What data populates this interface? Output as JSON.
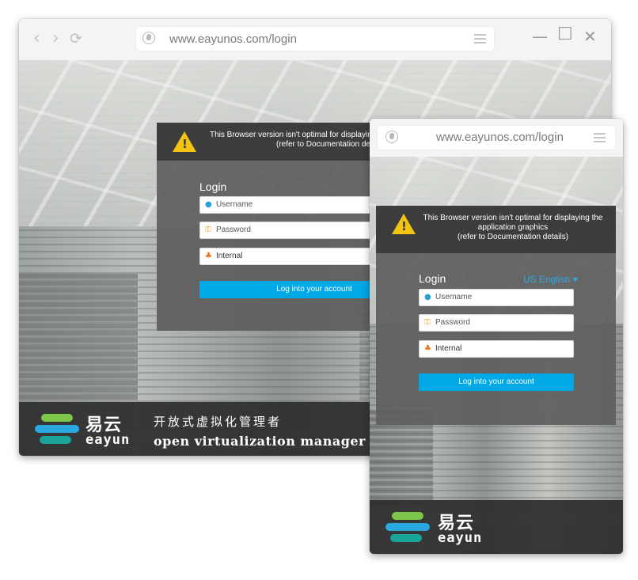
{
  "browser": {
    "url": "www.eayunos.com/login",
    "nav": {
      "back": "‹",
      "forward": "›",
      "reload": "⟳"
    },
    "window_controls": {
      "minimize": "—",
      "maximize": "☐",
      "close": "✕"
    }
  },
  "login_page": {
    "warning_line1": "This Browser version isn't optimal for displaying the application graphics",
    "warning_line1_cut": "This Browser version isn't optimal for displaying",
    "warning_line2_cut": "(refer to Documentation det",
    "warning_a": "This Browser version isn't optimal for displaying the",
    "warning_b": "application graphics",
    "warning_c": "(refer to Documentation details)",
    "login_label": "Login",
    "locale": "US English ▾",
    "username_placeholder": "Username",
    "password_placeholder": "Password",
    "profile_value": "Internal",
    "login_button": "Log into your account"
  },
  "branding": {
    "logo_cn": "易云",
    "logo_en": "eayun",
    "tagline_cn": "开放式虚拟化管理者",
    "tagline_en": "open virtualization manager"
  },
  "colors": {
    "accent": "#00a8e6",
    "warning": "#f4c415",
    "logo_green": "#7ec64a",
    "logo_blue": "#2aa8e0",
    "logo_teal": "#1aa39a"
  },
  "icons": [
    "back-icon",
    "forward-icon",
    "reload-icon",
    "globe-icon",
    "menu-icon",
    "minimize-icon",
    "maximize-icon",
    "close-icon",
    "warning-icon",
    "user-icon",
    "key-icon",
    "profile-icon"
  ]
}
